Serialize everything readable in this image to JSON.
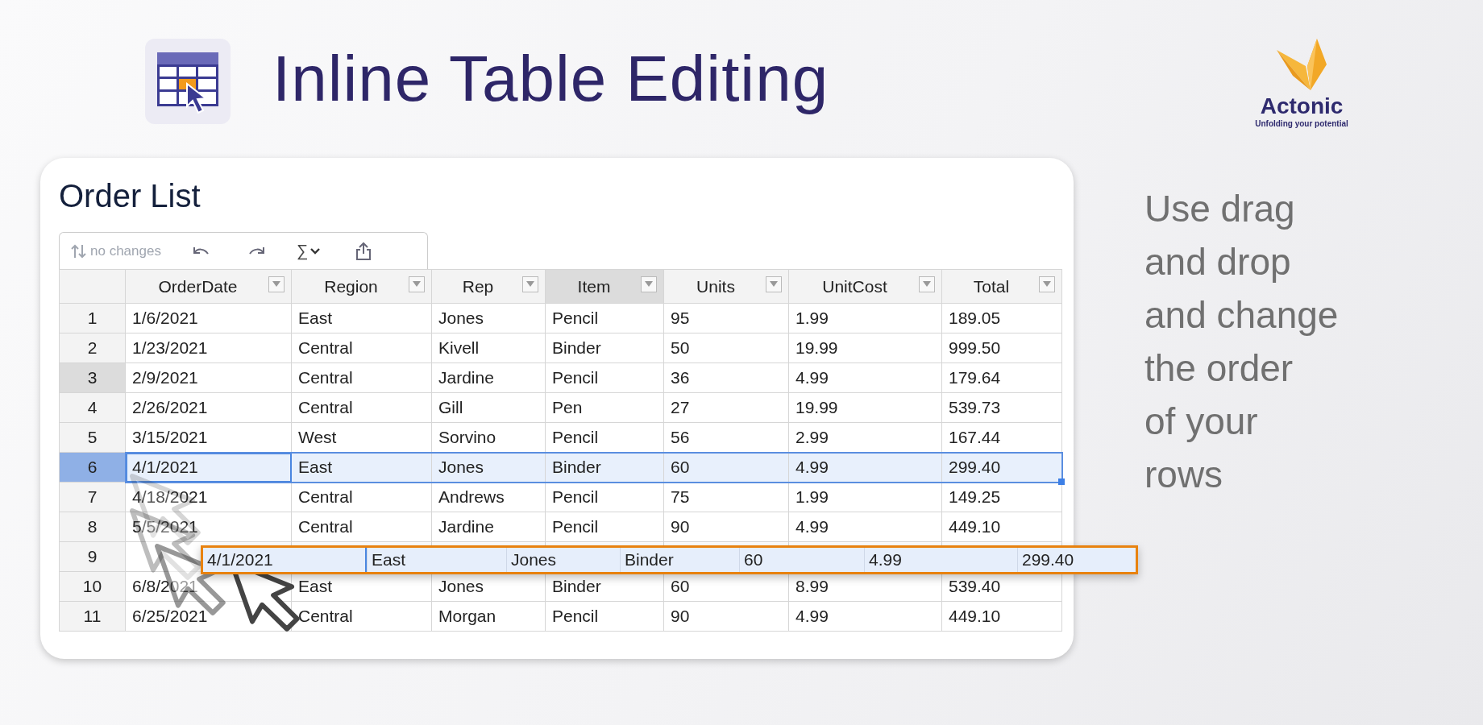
{
  "header": {
    "title": "Inline Table Editing"
  },
  "logo": {
    "name": "Actonic",
    "tagline": "Unfolding your potential"
  },
  "card": {
    "title": "Order List",
    "toolbar": {
      "status": "no changes",
      "sum_symbol": "∑"
    },
    "columns": [
      {
        "label": "OrderDate",
        "highlighted": false
      },
      {
        "label": "Region",
        "highlighted": false
      },
      {
        "label": "Rep",
        "highlighted": false
      },
      {
        "label": "Item",
        "highlighted": true
      },
      {
        "label": "Units",
        "highlighted": false
      },
      {
        "label": "UnitCost",
        "highlighted": false
      },
      {
        "label": "Total",
        "highlighted": false
      }
    ],
    "rows": [
      {
        "num": "1",
        "selected": false,
        "hovered": false,
        "cells": [
          "1/6/2021",
          "East",
          "Jones",
          "Pencil",
          "95",
          "1.99",
          "189.05"
        ]
      },
      {
        "num": "2",
        "selected": false,
        "hovered": false,
        "cells": [
          "1/23/2021",
          "Central",
          "Kivell",
          "Binder",
          "50",
          "19.99",
          "999.50"
        ]
      },
      {
        "num": "3",
        "selected": false,
        "hovered": true,
        "cells": [
          "2/9/2021",
          "Central",
          "Jardine",
          "Pencil",
          "36",
          "4.99",
          "179.64"
        ]
      },
      {
        "num": "4",
        "selected": false,
        "hovered": false,
        "cells": [
          "2/26/2021",
          "Central",
          "Gill",
          "Pen",
          "27",
          "19.99",
          "539.73"
        ]
      },
      {
        "num": "5",
        "selected": false,
        "hovered": false,
        "cells": [
          "3/15/2021",
          "West",
          "Sorvino",
          "Pencil",
          "56",
          "2.99",
          "167.44"
        ]
      },
      {
        "num": "6",
        "selected": true,
        "hovered": false,
        "cells": [
          "4/1/2021",
          "East",
          "Jones",
          "Binder",
          "60",
          "4.99",
          "299.40"
        ]
      },
      {
        "num": "7",
        "selected": false,
        "hovered": false,
        "cells": [
          "4/18/2021",
          "Central",
          "Andrews",
          "Pencil",
          "75",
          "1.99",
          "149.25"
        ]
      },
      {
        "num": "8",
        "selected": false,
        "hovered": false,
        "cells": [
          "5/5/2021",
          "Central",
          "Jardine",
          "Pencil",
          "90",
          "4.99",
          "449.10"
        ]
      },
      {
        "num": "9",
        "selected": false,
        "hovered": false,
        "cells": []
      },
      {
        "num": "10",
        "selected": false,
        "hovered": false,
        "cells": [
          "6/8/2021",
          "East",
          "Jones",
          "Binder",
          "60",
          "8.99",
          "539.40"
        ]
      },
      {
        "num": "11",
        "selected": false,
        "hovered": false,
        "cells": [
          "6/25/2021",
          "Central",
          "Morgan",
          "Pencil",
          "90",
          "4.99",
          "449.10"
        ]
      }
    ],
    "dragged_row": {
      "cells": [
        "4/1/2021",
        "East",
        "Jones",
        "Binder",
        "60",
        "4.99",
        "299.40"
      ]
    }
  },
  "side_note": {
    "lines": [
      "Use drag",
      "and drop",
      "and change",
      "the order",
      "of your",
      "rows"
    ]
  }
}
